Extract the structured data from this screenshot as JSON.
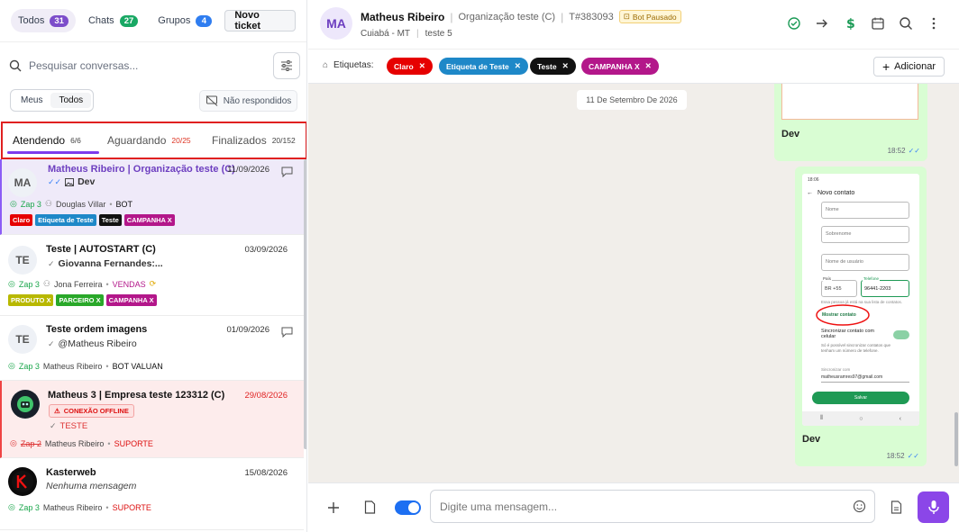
{
  "filters": {
    "todos": {
      "label": "Todos",
      "count": "31"
    },
    "chats": {
      "label": "Chats",
      "count": "27"
    },
    "grupos": {
      "label": "Grupos",
      "count": "4"
    },
    "new_ticket": "Novo ticket"
  },
  "search": {
    "placeholder": "Pesquisar conversas..."
  },
  "scope": {
    "meus": "Meus",
    "todos": "Todos"
  },
  "no_reply": "Não respondidos",
  "tabs": [
    {
      "label": "Atendendo",
      "count": "6/6"
    },
    {
      "label": "Aguardando",
      "count": "20/25"
    },
    {
      "label": "Finalizados",
      "count": "20/152"
    }
  ],
  "conversations": [
    {
      "avatar": "MA",
      "name": "Matheus Ribeiro | Organização teste (C)",
      "date": "11/09/2026",
      "last": "Dev",
      "connection": "Zap 3",
      "agent": "Douglas Villar",
      "queue": "BOT",
      "tags": [
        {
          "label": "Claro",
          "color": "#e60000"
        },
        {
          "label": "Etiqueta de Teste",
          "color": "#1e88c8"
        },
        {
          "label": "Teste",
          "color": "#111111"
        },
        {
          "label": "CAMPANHA X",
          "color": "#b3178a"
        }
      ]
    },
    {
      "avatar": "TE",
      "name": "Teste | AUTOSTART (C)",
      "date": "03/09/2026",
      "last": "Giovanna Fernandes:...",
      "connection": "Zap 3",
      "agent": "Jona Ferreira",
      "queue": "VENDAS",
      "tags": [
        {
          "label": "PRODUTO X",
          "color": "#b8b800"
        },
        {
          "label": "PARCEIRO X",
          "color": "#29a829"
        },
        {
          "label": "CAMPANHA X",
          "color": "#b3178a"
        }
      ]
    },
    {
      "avatar": "TE",
      "name": "Teste ordem imagens",
      "date": "01/09/2026",
      "last": "@Matheus Ribeiro",
      "connection": "Zap 3",
      "agent": "Matheus Ribeiro",
      "queue": "BOT VALUAN"
    },
    {
      "name": "Matheus 3 | Empresa teste 123312 (C)",
      "date": "29/08/2026",
      "badge": "CONEXÃO OFFLINE",
      "last": "TESTE",
      "connection": "Zap 2",
      "agent": "Matheus Ribeiro",
      "queue": "SUPORTE"
    },
    {
      "name": "Kasterweb",
      "date": "15/08/2026",
      "last": "Nenhuma mensagem",
      "connection": "Zap 3",
      "agent": "Matheus Ribeiro",
      "queue": "SUPORTE"
    }
  ],
  "chat": {
    "avatar": "MA",
    "name": "Matheus Ribeiro",
    "org": "Organização teste (C)",
    "ticket": "T#383093",
    "bot_status": "Bot Pausado",
    "city": "Cuiabá - MT",
    "group": "teste 5",
    "tags_label": "Etiquetas:",
    "tags": [
      {
        "label": "Claro",
        "color": "#e60000"
      },
      {
        "label": "Etiqueta de Teste",
        "color": "#1e88c8"
      },
      {
        "label": "Teste",
        "color": "#111111"
      },
      {
        "label": "CAMPANHA X",
        "color": "#b3178a"
      }
    ],
    "add_label": "Adicionar",
    "date_divider": "11 De Setembro De 2026",
    "messages": [
      {
        "text": "Dev",
        "time": "18:52"
      },
      {
        "text": "Dev",
        "time": "18:52"
      }
    ],
    "composer_placeholder": "Digite uma mensagem..."
  },
  "phone_shot": {
    "clock": "18:06",
    "title": "Novo contato",
    "fields": [
      "Nome",
      "Sobrenome",
      "Nome de usuário"
    ],
    "country_label": "País",
    "country": "BR +55",
    "phone_label": "Telefone",
    "phone": "96441-2203",
    "hint": "Essa pessoa já está na sua lista de contatos.",
    "show_contact": "Mostrar contato",
    "sync_title": "Sincronizar contato com celular",
    "sync_desc": "Só é possível sincronizar contatos que tenham um número de telefone.",
    "save_in_label": "Sincronizar com",
    "email": "matheusramres97@gmail.com",
    "save_btn": "Salvar"
  }
}
